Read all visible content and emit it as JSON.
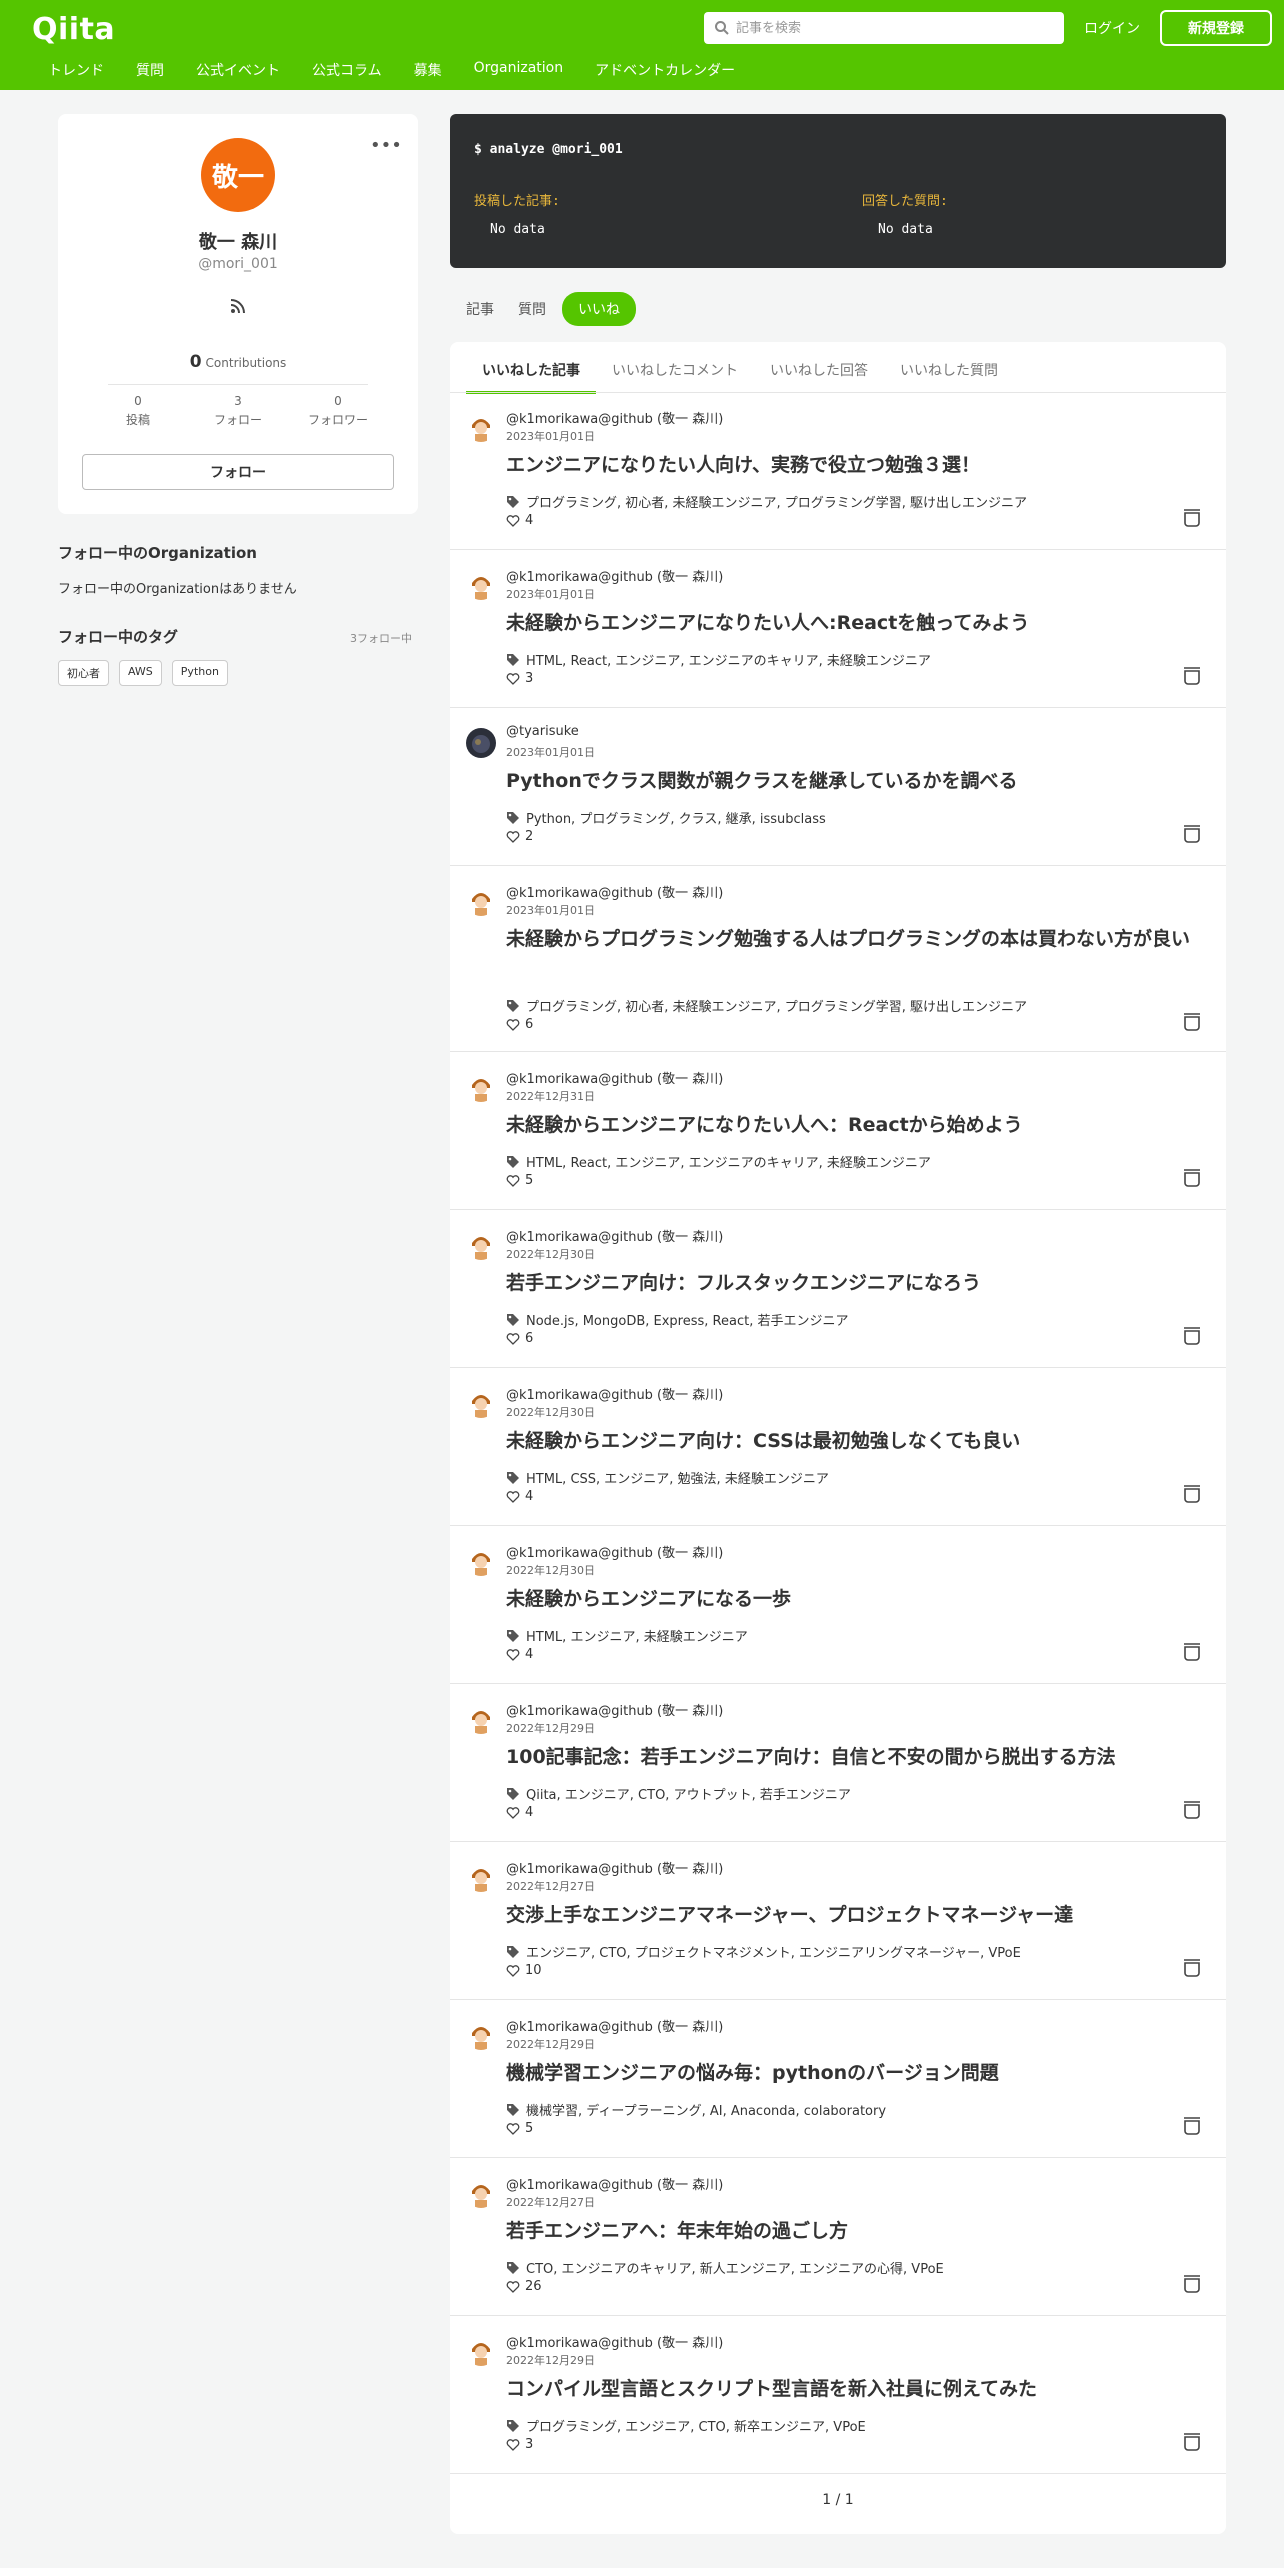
{
  "header": {
    "logo": "Qiita",
    "search_placeholder": "記事を検索",
    "login": "ログイン",
    "signup": "新規登録",
    "nav": [
      "トレンド",
      "質問",
      "公式イベント",
      "公式コラム",
      "募集",
      "Organization",
      "アドベントカレンダー"
    ]
  },
  "profile": {
    "avatar_text": "敬一",
    "more": "•••",
    "name": "敬一 森川",
    "id": "@mori_001",
    "contributions_count": "0",
    "contributions_label": "Contributions",
    "stats": [
      {
        "n": "0",
        "label": "投稿"
      },
      {
        "n": "3",
        "label": "フォロー"
      },
      {
        "n": "0",
        "label": "フォロワー"
      }
    ],
    "follow_button": "フォロー"
  },
  "organizations": {
    "title": "フォロー中のOrganization",
    "empty": "フォロー中のOrganizationはありません"
  },
  "followed_tags": {
    "title": "フォロー中のタグ",
    "count": "3フォロー中",
    "items": [
      "初心者",
      "AWS",
      "Python"
    ]
  },
  "analyze": {
    "command": "$ analyze @mori_001",
    "posted_label": "投稿した記事:",
    "posted_value": "No data",
    "answered_label": "回答した質問:",
    "answered_value": "No data"
  },
  "profile_tabs": [
    "記事",
    "質問",
    "いいね"
  ],
  "like_tabs": [
    "いいねした記事",
    "いいねしたコメント",
    "いいねした回答",
    "いいねした質問"
  ],
  "items": [
    {
      "author": "@k1morikawa@github (敬一 森川)",
      "date": "2023年01月01日",
      "title": "エンジニアになりたい人向け、実務で役立つ勉強３選！",
      "tags": "プログラミング, 初心者, 未経験エンジニア, プログラミング学習, 駆け出しエンジニア",
      "likes": "4"
    },
    {
      "author": "@k1morikawa@github (敬一 森川)",
      "date": "2023年01月01日",
      "title": "未経験からエンジニアになりたい人へ:Reactを触ってみよう",
      "tags": "HTML, React, エンジニア, エンジニアのキャリア, 未経験エンジニア",
      "likes": "3"
    },
    {
      "author": "@tyarisuke",
      "date": "2023年01月01日",
      "title": "Pythonでクラス関数が親クラスを継承しているかを調べる",
      "tags": "Python, プログラミング, クラス, 継承, issubclass",
      "likes": "2"
    },
    {
      "author": "@k1morikawa@github (敬一 森川)",
      "date": "2023年01月01日",
      "title": "未経験からプログラミング勉強する人はプログラミングの本は買わない方が良い",
      "tags": "プログラミング, 初心者, 未経験エンジニア, プログラミング学習, 駆け出しエンジニア",
      "likes": "6"
    },
    {
      "author": "@k1morikawa@github (敬一 森川)",
      "date": "2022年12月31日",
      "title": "未経験からエンジニアになりたい人へ：Reactから始めよう",
      "tags": "HTML, React, エンジニア, エンジニアのキャリア, 未経験エンジニア",
      "likes": "5"
    },
    {
      "author": "@k1morikawa@github (敬一 森川)",
      "date": "2022年12月30日",
      "title": "若手エンジニア向け：フルスタックエンジニアになろう",
      "tags": "Node.js, MongoDB, Express, React, 若手エンジニア",
      "likes": "6"
    },
    {
      "author": "@k1morikawa@github (敬一 森川)",
      "date": "2022年12月30日",
      "title": "未経験からエンジニア向け：CSSは最初勉強しなくても良い",
      "tags": "HTML, CSS, エンジニア, 勉強法, 未経験エンジニア",
      "likes": "4"
    },
    {
      "author": "@k1morikawa@github (敬一 森川)",
      "date": "2022年12月30日",
      "title": "未経験からエンジニアになる一歩",
      "tags": "HTML, エンジニア, 未経験エンジニア",
      "likes": "4"
    },
    {
      "author": "@k1morikawa@github (敬一 森川)",
      "date": "2022年12月29日",
      "title": "100記事記念：若手エンジニア向け：自信と不安の間から脱出する方法",
      "tags": "Qiita, エンジニア, CTO, アウトプット, 若手エンジニア",
      "likes": "4"
    },
    {
      "author": "@k1morikawa@github (敬一 森川)",
      "date": "2022年12月27日",
      "title": "交渉上手なエンジニアマネージャー、プロジェクトマネージャー達",
      "tags": "エンジニア, CTO, プロジェクトマネジメント, エンジニアリングマネージャー, VPoE",
      "likes": "10"
    },
    {
      "author": "@k1morikawa@github (敬一 森川)",
      "date": "2022年12月29日",
      "title": "機械学習エンジニアの悩み毎：pythonのバージョン問題",
      "tags": "機械学習, ディープラーニング, AI, Anaconda, colaboratory",
      "likes": "5"
    },
    {
      "author": "@k1morikawa@github (敬一 森川)",
      "date": "2022年12月27日",
      "title": "若手エンジニアへ：年末年始の過ごし方",
      "tags": "CTO, エンジニアのキャリア, 新人エンジニア, エンジニアの心得, VPoE",
      "likes": "26"
    },
    {
      "author": "@k1morikawa@github (敬一 森川)",
      "date": "2022年12月29日",
      "title": "コンパイル型言語とスクリプト型言語を新入社員に例えてみた",
      "tags": "プログラミング, エンジニア, CTO, 新卒エンジニア, VPoE",
      "likes": "3"
    }
  ],
  "pager": "1 / 1",
  "colors": {
    "brand": "#55c500",
    "avatar_bg": "#f26b0f",
    "analyze_bg": "#2d2f30",
    "analyze_label": "#e7b63b"
  }
}
